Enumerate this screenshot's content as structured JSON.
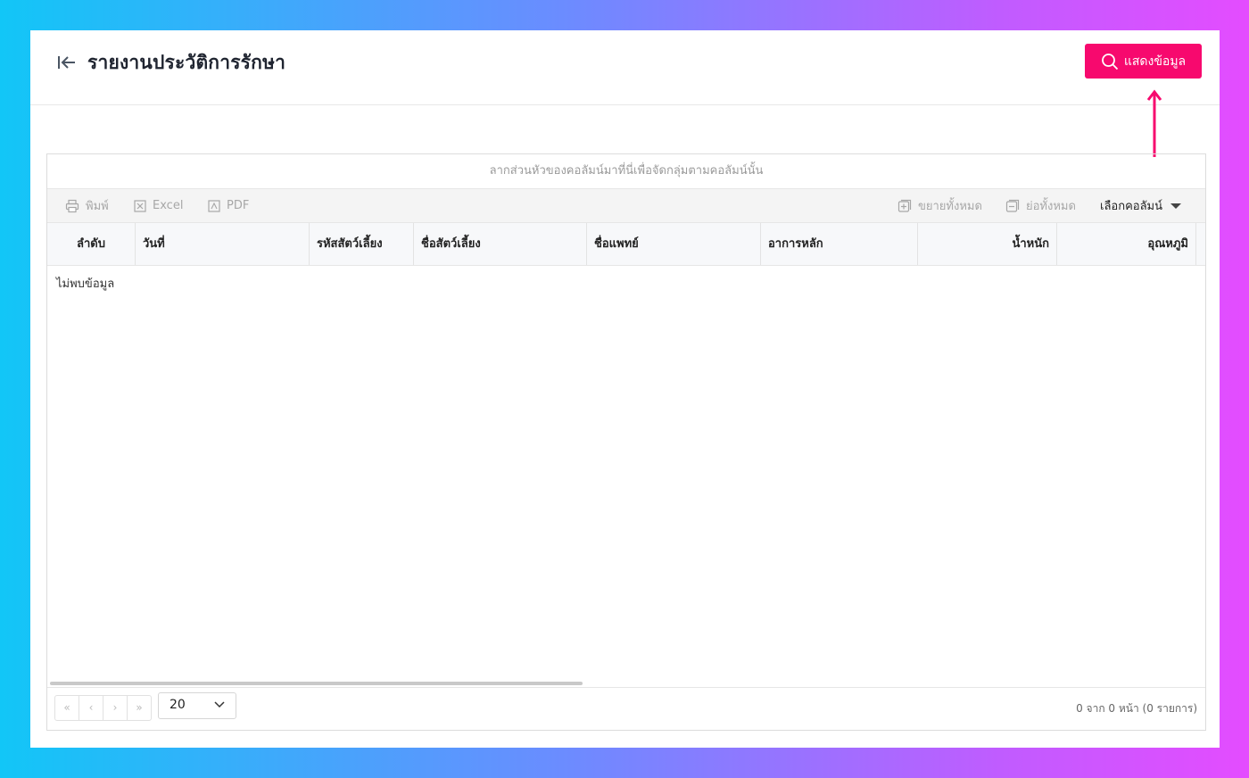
{
  "header": {
    "title": "รายงานประวัติการรักษา",
    "show_button_label": "แสดงข้อมูล"
  },
  "grid": {
    "group_panel_text": "ลากส่วนหัวของคอลัมน์มาที่นี่เพื่อจัดกลุ่มตามคอลัมน์นั้น",
    "toolbar": {
      "print_label": "พิมพ์",
      "excel_label": "Excel",
      "pdf_label": "PDF",
      "expand_all_label": "ขยายทั้งหมด",
      "collapse_all_label": "ย่อทั้งหมด",
      "column_chooser_label": "เลือกคอลัมน์"
    },
    "columns": [
      "ลำดับ",
      "วันที่",
      "รหัสสัตว์เลี้ยง",
      "ชื่อสัตว์เลี้ยง",
      "ชื่อแพทย์",
      "อาการหลัก",
      "น้ำหนัก",
      "อุณหภูมิ"
    ],
    "no_data_text": "ไม่พบข้อมูล",
    "pager": {
      "first": "«",
      "prev": "‹",
      "next": "›",
      "last": "»",
      "page_size": "20",
      "info": "0 จาก 0 หน้า (0 รายการ)"
    }
  },
  "colors": {
    "accent": "#f7096e"
  },
  "icons": [
    "back-icon",
    "search-icon",
    "print-icon",
    "excel-icon",
    "pdf-icon",
    "expand-icon",
    "collapse-icon",
    "dropdown-caret-icon",
    "chevron-down-icon",
    "up-arrow-icon"
  ]
}
